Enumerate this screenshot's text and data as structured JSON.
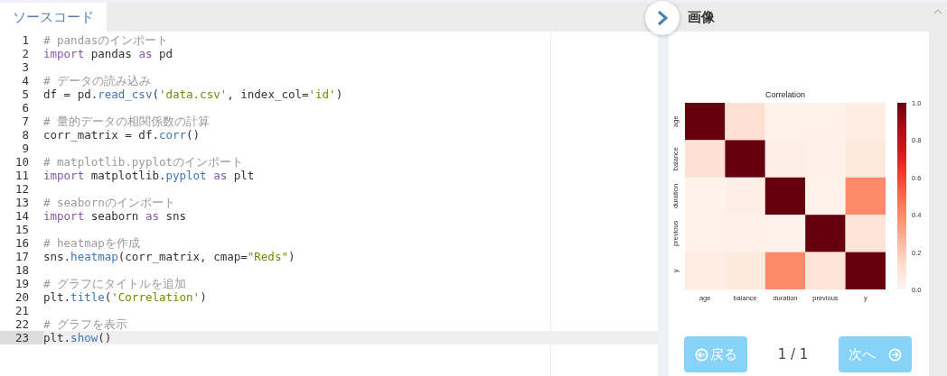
{
  "editor": {
    "tab": {
      "label": "ソースコード",
      "selected": true
    },
    "lines": [
      {
        "number": "1",
        "current": false,
        "tokens": [
          {
            "kind": "comment",
            "text": "# pandasのインポート"
          }
        ]
      },
      {
        "number": "2",
        "current": false,
        "tokens": [
          {
            "kind": "keyword",
            "text": "import"
          },
          {
            "kind": "text",
            "text": " pandas "
          },
          {
            "kind": "keyword",
            "text": "as"
          },
          {
            "kind": "text",
            "text": " pd"
          }
        ]
      },
      {
        "number": "3",
        "current": false
      },
      {
        "number": "4",
        "current": false,
        "tokens": [
          {
            "kind": "comment",
            "text": "# データの読み込み"
          }
        ]
      },
      {
        "number": "5",
        "current": false,
        "tokens": [
          {
            "kind": "text",
            "text": "df = pd."
          },
          {
            "kind": "function",
            "text": "read_csv"
          },
          {
            "kind": "text",
            "text": "("
          },
          {
            "kind": "string",
            "text": "'data.csv'"
          },
          {
            "kind": "text",
            "text": ", index_col="
          },
          {
            "kind": "string",
            "text": "'id'"
          },
          {
            "kind": "text",
            "text": ")"
          }
        ]
      },
      {
        "number": "6",
        "current": false
      },
      {
        "number": "7",
        "current": false,
        "tokens": [
          {
            "kind": "comment",
            "text": "# 量的データの相関係数の計算"
          }
        ]
      },
      {
        "number": "8",
        "current": false,
        "tokens": [
          {
            "kind": "text",
            "text": "corr_matrix = df."
          },
          {
            "kind": "function",
            "text": "corr"
          },
          {
            "kind": "text",
            "text": "()"
          }
        ]
      },
      {
        "number": "9",
        "current": false
      },
      {
        "number": "10",
        "current": false,
        "tokens": [
          {
            "kind": "comment",
            "text": "# matplotlib.pyplotのインポート"
          }
        ]
      },
      {
        "number": "11",
        "current": false,
        "tokens": [
          {
            "kind": "keyword",
            "text": "import"
          },
          {
            "kind": "text",
            "text": " matplotlib."
          },
          {
            "kind": "function",
            "text": "pyplot"
          },
          {
            "kind": "keyword",
            "text": " as"
          },
          {
            "kind": "text",
            "text": " plt"
          }
        ]
      },
      {
        "number": "12",
        "current": false
      },
      {
        "number": "13",
        "current": false,
        "tokens": [
          {
            "kind": "comment",
            "text": "# seabornのインポート"
          }
        ]
      },
      {
        "number": "14",
        "current": false,
        "tokens": [
          {
            "kind": "keyword",
            "text": "import"
          },
          {
            "kind": "text",
            "text": " seaborn "
          },
          {
            "kind": "keyword",
            "text": "as"
          },
          {
            "kind": "text",
            "text": " sns"
          }
        ]
      },
      {
        "number": "15",
        "current": false
      },
      {
        "number": "16",
        "current": false,
        "tokens": [
          {
            "kind": "comment",
            "text": "# heatmapを作成"
          }
        ]
      },
      {
        "number": "17",
        "current": false,
        "tokens": [
          {
            "kind": "text",
            "text": "sns."
          },
          {
            "kind": "function",
            "text": "heatmap"
          },
          {
            "kind": "text",
            "text": "(corr_matrix, cmap="
          },
          {
            "kind": "string",
            "text": "\"Reds\""
          },
          {
            "kind": "text",
            "text": ")"
          }
        ]
      },
      {
        "number": "18",
        "current": false
      },
      {
        "number": "19",
        "current": false,
        "tokens": [
          {
            "kind": "comment",
            "text": "# グラフにタイトルを追加"
          }
        ]
      },
      {
        "number": "20",
        "current": false,
        "tokens": [
          {
            "kind": "text",
            "text": "plt."
          },
          {
            "kind": "function",
            "text": "title"
          },
          {
            "kind": "text",
            "text": "("
          },
          {
            "kind": "string",
            "text": "'Correlation'"
          },
          {
            "kind": "text",
            "text": ")"
          }
        ]
      },
      {
        "number": "21",
        "current": false
      },
      {
        "number": "22",
        "current": false,
        "tokens": [
          {
            "kind": "comment",
            "text": "# グラフを表示"
          }
        ]
      },
      {
        "number": "23",
        "current": true,
        "tokens": [
          {
            "kind": "text",
            "text": "plt."
          },
          {
            "kind": "function",
            "text": "show"
          },
          {
            "kind": "text",
            "text": "()"
          }
        ]
      }
    ]
  },
  "image_panel": {
    "title": "画像",
    "heatmap": {
      "title": "Correlation",
      "x_labels": [
        "age",
        "balance",
        "duration",
        "previous",
        "y"
      ],
      "y_labels": [
        "age",
        "balance",
        "duration",
        "previous",
        "y"
      ],
      "colorbar_labels": [
        "1.0",
        "0.8",
        "0.6",
        "0.4",
        "0.2",
        "0.0"
      ]
    },
    "back_button": "戻る",
    "page": "1 / 1",
    "next_button": "次へ"
  }
}
